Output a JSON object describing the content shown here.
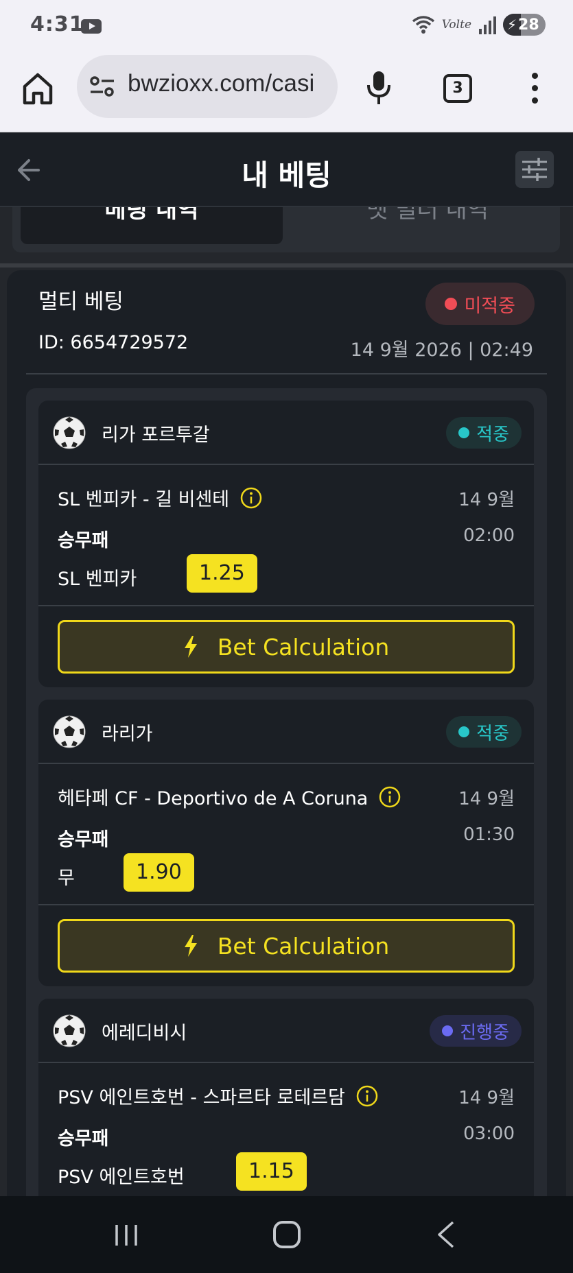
{
  "status_bar": {
    "time": "4:31",
    "network_label": "Volte",
    "battery": "28"
  },
  "browser": {
    "url": "bwzioxx.com/casi",
    "tab_count": "3"
  },
  "header": {
    "title": "내 베팅"
  },
  "tabs": [
    {
      "label": "베팅 내역",
      "active": true
    },
    {
      "label": "벳 빌더 내역",
      "active": false
    }
  ],
  "bet": {
    "title": "멀티 베팅",
    "status": "미적중",
    "id": "ID: 6654729572",
    "datetime": "14 9월 2026 | 02:49",
    "status_color": "#f14d56"
  },
  "selections": [
    {
      "league": "리가 포르투갈",
      "result": "적중",
      "match": "SL 벤피카 - 길 비센테",
      "date": "14 9월",
      "market": "승무패",
      "time": "02:00",
      "pick": "SL 벤피카",
      "odds": "1.25",
      "calc_label": "Bet Calculation"
    },
    {
      "league": "라리가",
      "result": "적중",
      "match": "헤타페 CF - Deportivo de A Coruna",
      "date": "14 9월",
      "market": "승무패",
      "time": "01:30",
      "pick": "무",
      "odds": "1.90",
      "calc_label": "Bet Calculation"
    },
    {
      "league": "에레디비시",
      "result": "진행중",
      "match": "PSV 에인트호번 - 스파르타 로테르담",
      "date": "14 9월",
      "market": "승무패",
      "time": "03:00",
      "pick": "PSV 에인트호번",
      "odds": "1.15"
    }
  ],
  "colors": {
    "accent_yellow": "#f5e221",
    "win_teal": "#28c7c9",
    "live_purple": "#6b6bf2",
    "background": "#1b1f25"
  }
}
